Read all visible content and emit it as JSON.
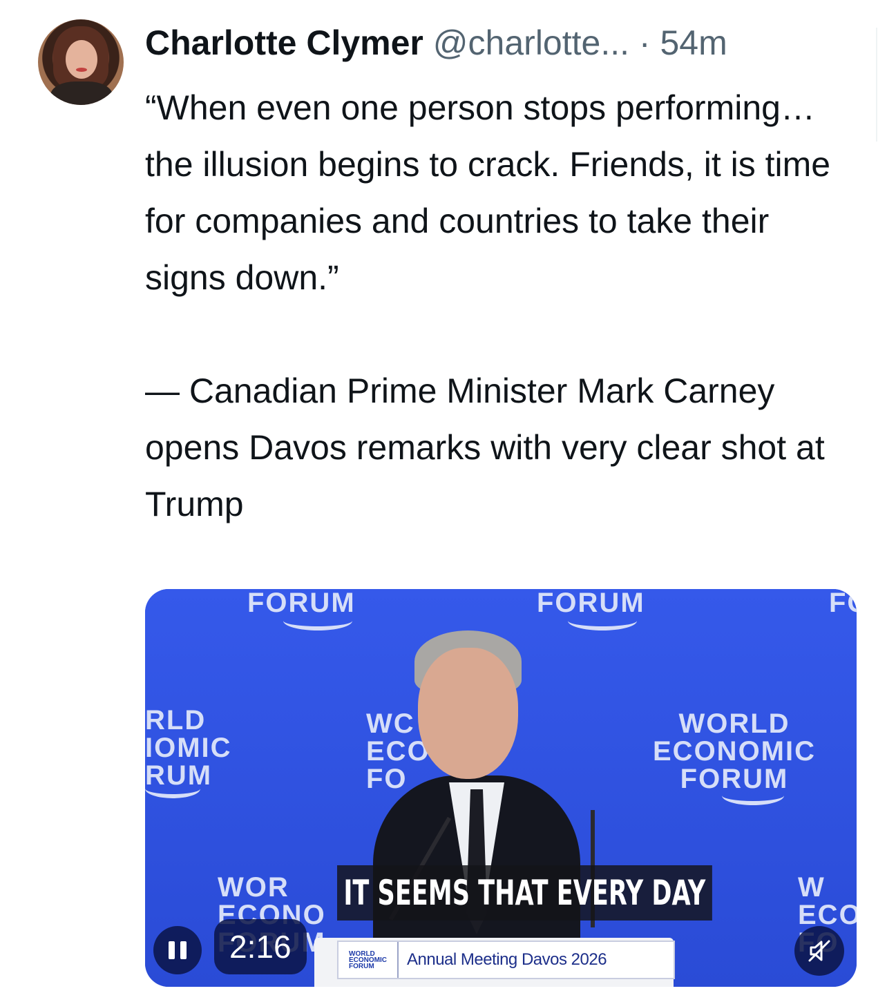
{
  "tweet": {
    "author_name": "Charlotte Clymer",
    "handle": "@charlotte...",
    "separator": "·",
    "time": "54m",
    "text_lines": [
      "“When even one person stops performing… the illusion begins to crack. Friends, it is time for companies and countries to take their signs down.”",
      "— Canadian Prime Minister Mark Carney opens Davos remarks with very clear shot at Trump"
    ]
  },
  "video": {
    "backdrop_texts": {
      "forum_top_1": "FORUM",
      "forum_top_2": "FORUM",
      "forum_top_3": "FO",
      "left_partial": "RLD\nIOMIC\nRUM",
      "center_partial": "WC\nECON\nFO",
      "right_full": "WORLD\nECONOMIC\nFORUM",
      "bottom_left": "WOR\nECONO\nFORUM",
      "bottom_right": "W\nECO\nFO"
    },
    "caption": "IT SEEMS THAT EVERY DAY",
    "podium_logo": "WORLD\nECONOMIC\nFORUM",
    "podium_label": "Annual Meeting Davos 2026",
    "time": "2:16",
    "colors": {
      "background": "#2f52e0",
      "controls": "#0a1446"
    }
  }
}
